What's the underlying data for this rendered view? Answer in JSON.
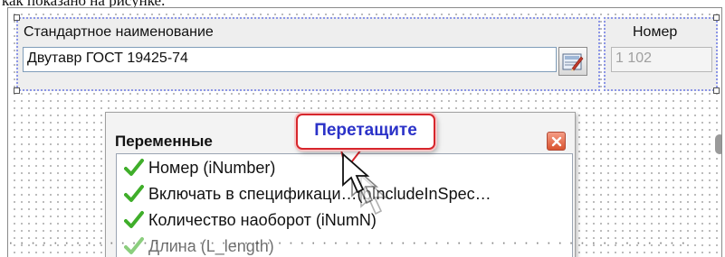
{
  "caption": "как показано на рисунке.",
  "form": {
    "name_label": "Стандартное наименование",
    "name_value": "Двутавр ГОСТ 19425-74",
    "number_label": "Номер",
    "number_value": "1 102"
  },
  "panel": {
    "title": "Переменные",
    "items": [
      {
        "label": "Номер (iNumber)"
      },
      {
        "label": "Включать в спецификаци…(bIncludeInSpec…"
      },
      {
        "label": "Количество наоборот (iNumN)"
      },
      {
        "label": "Длина (L_length)"
      }
    ]
  },
  "callout": {
    "text": "Перетащите"
  },
  "colors": {
    "accent": "#2b32c8",
    "callout_border": "#d7262c",
    "check": "#3fae2a",
    "group_border": "#8c96e6"
  },
  "icons": [
    "pick-icon",
    "close-icon",
    "check-icon",
    "cursor-icon"
  ]
}
